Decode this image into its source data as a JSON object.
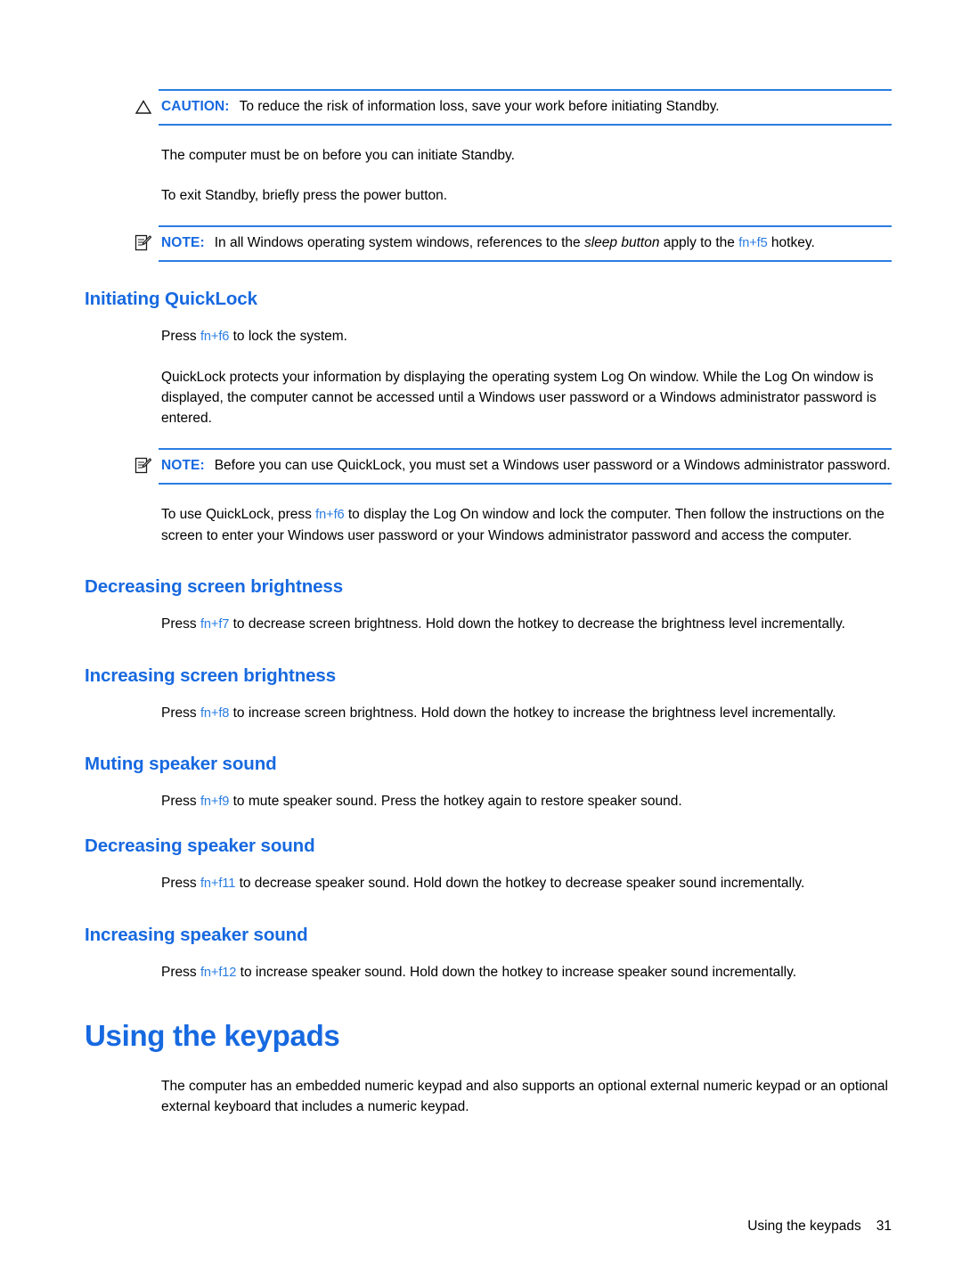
{
  "page": {
    "footer_section": "Using the keypads",
    "footer_page_number": "31"
  },
  "colors": {
    "heading_blue": "#1769e0",
    "rule_blue": "#2a7de1",
    "hotkey_blue": "#2a7de1",
    "body_black": "#000000",
    "background": "#ffffff"
  },
  "blocks": {
    "caution_standby": {
      "icon": "caution-triangle-icon",
      "label": "CAUTION:",
      "text": "To reduce the risk of information loss, save your work before initiating Standby."
    },
    "para_computer_on": "The computer must be on before you can initiate Standby.",
    "para_exit_standby": "To exit Standby, briefly press the power button.",
    "note_sleep_button": {
      "icon": "note-pencil-icon",
      "label": "NOTE:",
      "text_before": "In all Windows operating system windows, references to the",
      "emphasis": "sleep button",
      "text_middle": "apply to the",
      "hotkey": "fn+f5",
      "text_after": "hotkey."
    },
    "section_quicklock": {
      "heading": "Initiating QuickLock",
      "para_press": {
        "before": "Press",
        "hotkey": "fn+f6",
        "after": "to lock the system."
      },
      "para_protects": "QuickLock protects your information by displaying the operating system Log On window. While the Log On window is displayed, the computer cannot be accessed until a Windows user password or a Windows administrator password is entered.",
      "note_password": {
        "icon": "note-pencil-icon",
        "label": "NOTE:",
        "text": "Before you can use QuickLock, you must set a Windows user password or a Windows administrator password."
      },
      "para_touse": {
        "before": "To use QuickLock, press",
        "hotkey": "fn+f6",
        "after": "to display the Log On window and lock the computer. Then follow the instructions on the screen to enter your Windows user password or your Windows administrator password and access the computer."
      }
    },
    "section_decrease_brightness": {
      "heading": "Decreasing screen brightness",
      "para": {
        "before": "Press",
        "hotkey": "fn+f7",
        "after": "to decrease screen brightness. Hold down the hotkey to decrease the brightness level incrementally."
      }
    },
    "section_increase_brightness": {
      "heading": "Increasing screen brightness",
      "para": {
        "before": "Press",
        "hotkey": "fn+f8",
        "after": "to increase screen brightness. Hold down the hotkey to increase the brightness level incrementally."
      }
    },
    "section_mute_speaker": {
      "heading": "Muting speaker sound",
      "para": {
        "before": "Press",
        "hotkey": "fn+f9",
        "after": "to mute speaker sound. Press the hotkey again to restore speaker sound."
      }
    },
    "section_decrease_speaker": {
      "heading": "Decreasing speaker sound",
      "para": {
        "before": "Press",
        "hotkey": "fn+f11",
        "after": "to decrease speaker sound. Hold down the hotkey to decrease speaker sound incrementally."
      }
    },
    "section_increase_speaker": {
      "heading": "Increasing speaker sound",
      "para": {
        "before": "Press",
        "hotkey": "fn+f12",
        "after": "to increase speaker sound. Hold down the hotkey to increase speaker sound incrementally."
      }
    },
    "section_keypads": {
      "heading": "Using the keypads",
      "para": "The computer has an embedded numeric keypad and also supports an optional external numeric keypad or an optional external keyboard that includes a numeric keypad."
    }
  }
}
